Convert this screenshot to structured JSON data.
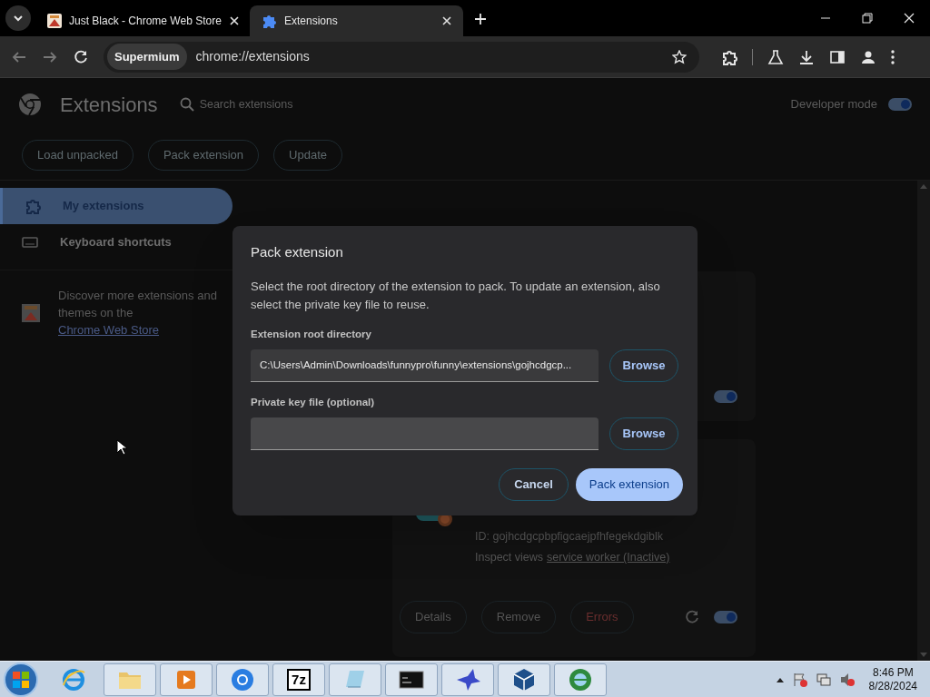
{
  "browser_tabs": [
    {
      "title": "Just Black - Chrome Web Store",
      "kind": "store",
      "selected": false
    },
    {
      "title": "Extensions",
      "kind": "puzzle",
      "selected": true
    }
  ],
  "address_bar": {
    "chip": "Supermium",
    "url": "chrome://extensions"
  },
  "page": {
    "title": "Extensions",
    "search": {
      "placeholder": "Search extensions"
    },
    "developer_mode": {
      "label": "Developer mode",
      "on": true
    },
    "actions": [
      "Load unpacked",
      "Pack extension",
      "Update"
    ],
    "sidebar": {
      "items": [
        {
          "label": "My extensions",
          "kind": "puzzle",
          "selected": true
        },
        {
          "label": "Keyboard shortcuts",
          "kind": "keyboard",
          "selected": false
        }
      ],
      "promo": {
        "text": "Discover more extensions and themes on the ",
        "link": "Chrome Web Store"
      }
    },
    "extension_cards": [
      {
        "enabled": true
      },
      {
        "id": "ID: gojhcdgcpbpfigcaejpfhfegekdgiblk",
        "inspect_label": "Inspect views",
        "inspect_link": "service worker (Inactive)",
        "buttons": [
          {
            "label": "Details",
            "kind": "normal"
          },
          {
            "label": "Remove",
            "kind": "normal"
          },
          {
            "label": "Errors",
            "kind": "error"
          }
        ],
        "enabled": true
      }
    ]
  },
  "dialog": {
    "title": "Pack extension",
    "description": "Select the root directory of the extension to pack. To update an extension, also select the private key file to reuse.",
    "fields": [
      {
        "label": "Extension root directory",
        "value": "C:\\Users\\Admin\\Downloads\\funnypro\\funny\\extensions\\gojhcdgcp...",
        "button": "Browse"
      },
      {
        "label": "Private key file (optional)",
        "button": "Browse"
      }
    ],
    "buttons": [
      {
        "label": "Cancel",
        "kind": "secondary"
      },
      {
        "label": "Pack extension",
        "kind": "primary"
      }
    ]
  },
  "taskbar": {
    "apps": [
      {
        "kind": "ie"
      },
      {
        "kind": "folder"
      },
      {
        "kind": "media"
      },
      {
        "kind": "chrome"
      },
      {
        "kind": "archive",
        "label": "7z"
      },
      {
        "kind": "notepad"
      },
      {
        "kind": "console"
      },
      {
        "kind": "bird"
      },
      {
        "kind": "cube"
      },
      {
        "kind": "globe"
      }
    ],
    "clock": {
      "time": "8:46 PM",
      "date": "8/28/2024"
    }
  }
}
